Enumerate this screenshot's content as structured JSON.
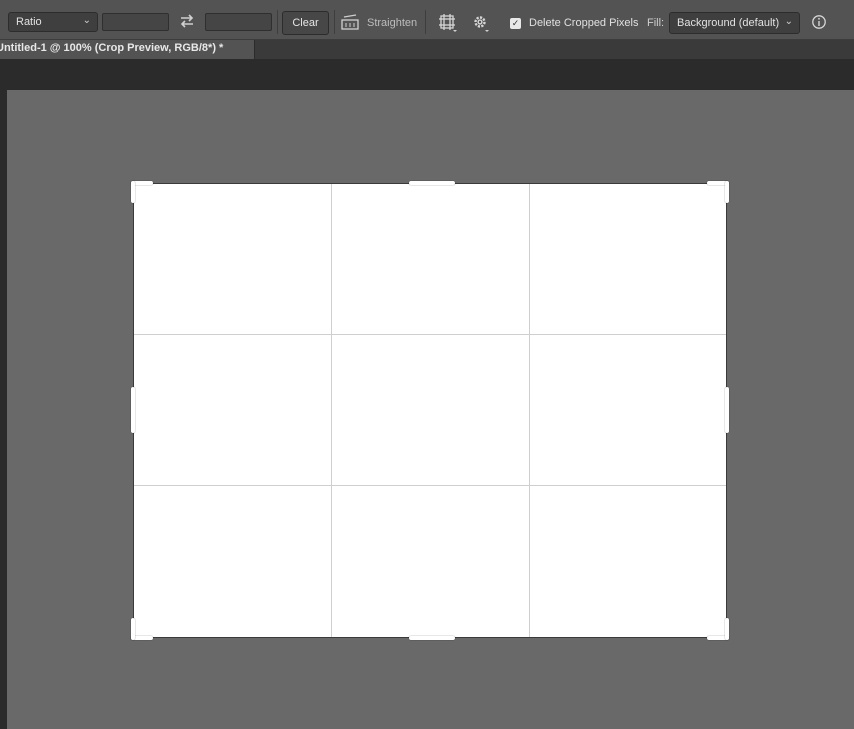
{
  "options_bar": {
    "ratio_select": {
      "value": "Ratio",
      "chevron": "⌄"
    },
    "ratio_width": "",
    "ratio_height": "",
    "clear_label": "Clear",
    "straighten_label": "Straighten",
    "delete_cropped_pixels": {
      "checked": true,
      "label": "Delete Cropped Pixels"
    },
    "fill_label": "Fill:",
    "fill_select": {
      "value": "Background (default)",
      "chevron": "⌄"
    }
  },
  "document_tab": {
    "title": "Untitled-1 @ 100% (Crop Preview, RGB/8*) *"
  },
  "icons": {
    "swap": "swap-arrows-icon",
    "straighten": "straighten-level-icon",
    "grid_overlay": "grid-overlay-icon",
    "settings": "gear-icon",
    "info": "info-icon"
  },
  "colors": {
    "workspace": "#696969",
    "document": "#ffffff",
    "guide": "#cfcfcf",
    "options_bar": "#535353"
  }
}
